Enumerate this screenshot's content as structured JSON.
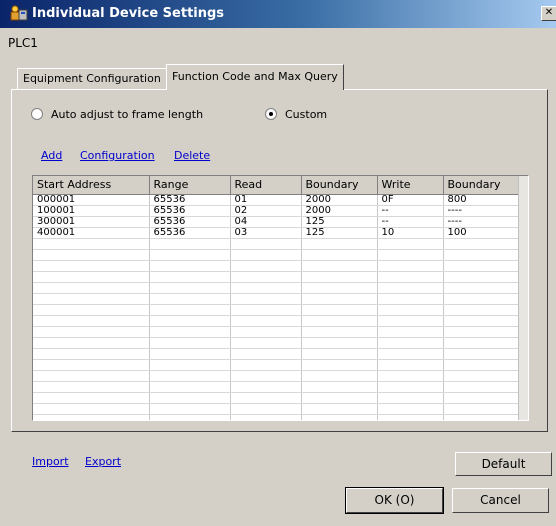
{
  "window": {
    "title": "Individual Device Settings",
    "close_glyph": "✕"
  },
  "device": {
    "name": "PLC1"
  },
  "tabs": [
    {
      "label": "Equipment Configuration",
      "active": false
    },
    {
      "label": "Function Code and Max Query",
      "active": true
    }
  ],
  "query_mode": {
    "options": [
      {
        "label": "Auto adjust to frame length",
        "checked": false
      },
      {
        "label": "Custom",
        "checked": true
      }
    ]
  },
  "actions": {
    "add": "Add",
    "configuration": "Configuration",
    "delete": "Delete"
  },
  "table": {
    "columns": [
      "Start Address",
      "Range",
      "Read",
      "Boundary",
      "Write",
      "Boundary"
    ],
    "rows": [
      [
        "000001",
        "65536",
        "01",
        "2000",
        "0F",
        "800"
      ],
      [
        "100001",
        "65536",
        "02",
        "2000",
        "--",
        "----"
      ],
      [
        "300001",
        "65536",
        "04",
        "125",
        "--",
        "----"
      ],
      [
        "400001",
        "65536",
        "03",
        "125",
        "10",
        "100"
      ]
    ],
    "empty_rows": 17
  },
  "footer": {
    "import": "Import",
    "export": "Export",
    "default": "Default",
    "ok": "OK (O)",
    "cancel": "Cancel"
  },
  "colors": {
    "title_start": "#0a246a",
    "link": "#0000cc",
    "face": "#d4d0c8"
  },
  "icons": {
    "title": "device-settings-icon"
  }
}
